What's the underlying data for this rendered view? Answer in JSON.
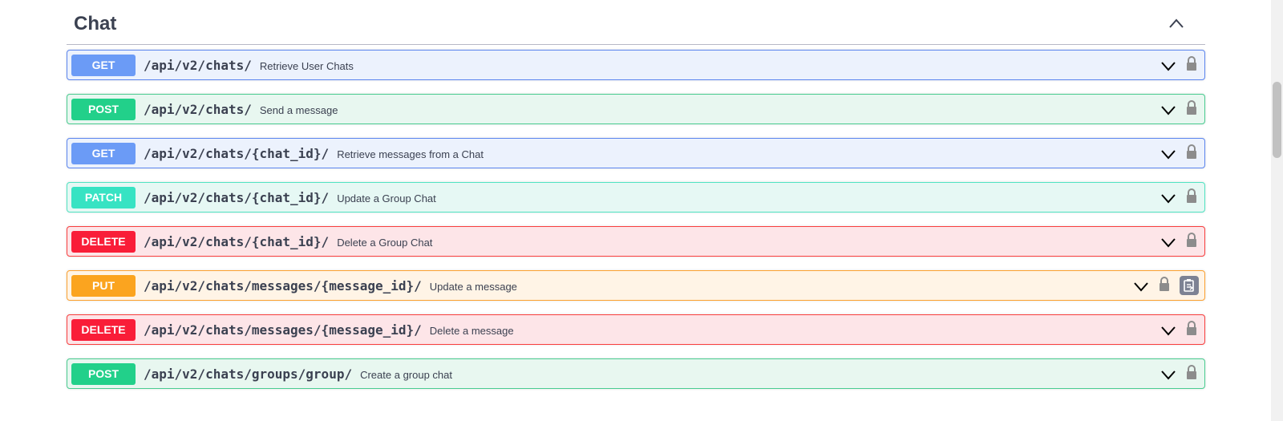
{
  "section": {
    "title": "Chat"
  },
  "operations": [
    {
      "method": "GET",
      "path": "/api/v2/chats/",
      "summary": "Retrieve User Chats"
    },
    {
      "method": "POST",
      "path": "/api/v2/chats/",
      "summary": "Send a message"
    },
    {
      "method": "GET",
      "path": "/api/v2/chats/{chat_id}/",
      "summary": "Retrieve messages from a Chat"
    },
    {
      "method": "PATCH",
      "path": "/api/v2/chats/{chat_id}/",
      "summary": "Update a Group Chat"
    },
    {
      "method": "DELETE",
      "path": "/api/v2/chats/{chat_id}/",
      "summary": "Delete a Group Chat"
    },
    {
      "method": "PUT",
      "path": "/api/v2/chats/messages/{message_id}/",
      "summary": "Update a message"
    },
    {
      "method": "DELETE",
      "path": "/api/v2/chats/messages/{message_id}/",
      "summary": "Delete a message"
    },
    {
      "method": "POST",
      "path": "/api/v2/chats/groups/group/",
      "summary": "Create a group chat"
    }
  ],
  "colors": {
    "get": "#6b9bf6",
    "post": "#22d08a",
    "patch": "#37e3c3",
    "delete": "#f91d38",
    "put": "#fba41f",
    "text": "#3b4151"
  },
  "icons": {
    "section_toggle": "chevron-up-icon",
    "expand": "chevron-down-icon",
    "auth": "lock-icon",
    "copy": "clipboard-icon"
  }
}
